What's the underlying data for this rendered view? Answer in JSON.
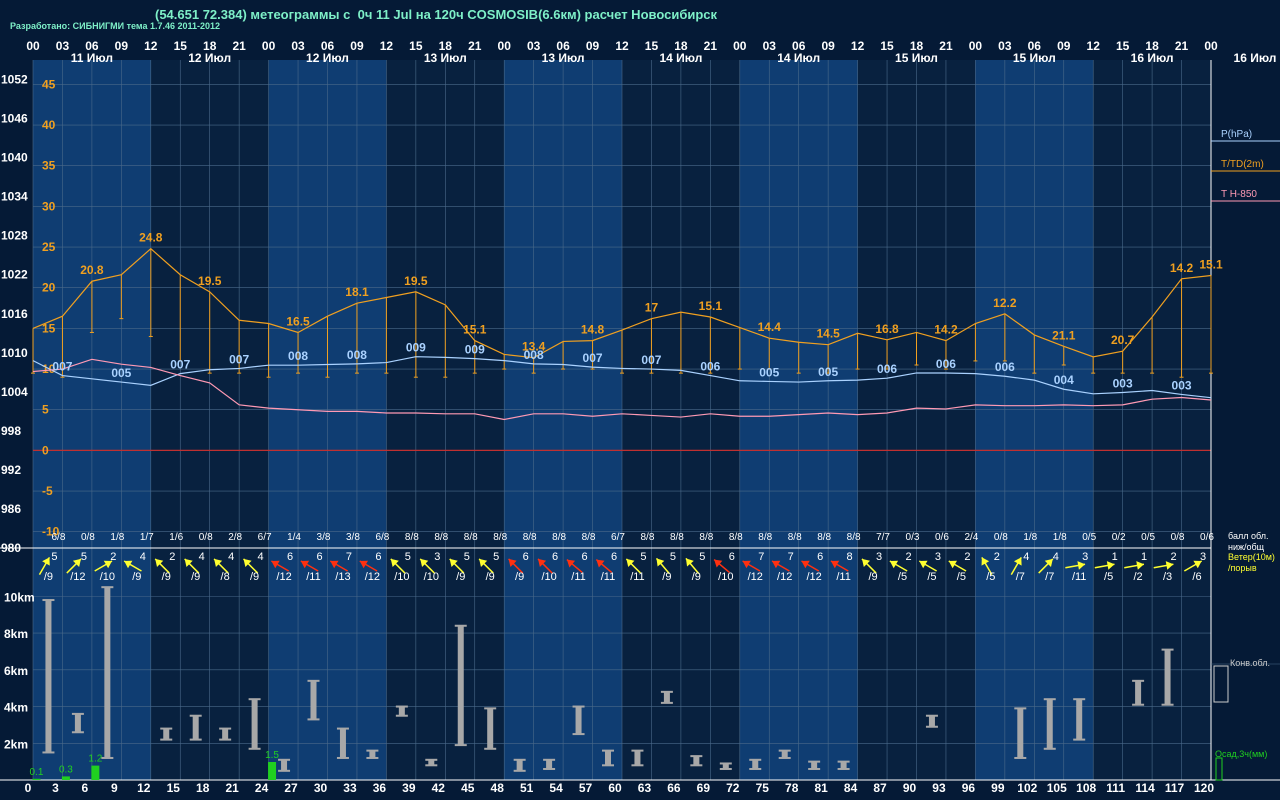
{
  "header": {
    "title": "(54.651 72.384) метеограммы с  0ч 11 Jul на 120ч COSMOSIB(6.6км) расчет Новосибирск",
    "credit": "Разработано: СИБНИГМИ тема 1.7.46 2011-2012"
  },
  "colors": {
    "background": "#051a36",
    "day_band": "#0f3d72",
    "night_band": "#08213f",
    "grid": "#4a6a8a",
    "temperature": "#f0a020",
    "pressure": "#aad2ff",
    "t850": "#ff9ab4",
    "zero_line": "#c03030",
    "wind_light": "#ffff30",
    "wind_strong": "#ff3010",
    "cloud_bar": "#a8a8a8",
    "precip": "#20d020",
    "axis_text": "#ffffff"
  },
  "legend": {
    "pressure": "P(hPa)",
    "temperature": "T/TD(2m)",
    "t850": "T H-850",
    "cloud_cover_line1": "балл обл.",
    "cloud_cover_line2": "ниж/общ",
    "wind_line1": "Ветер(10м)",
    "wind_line2": "/порыв",
    "convective": "Конв.обл.",
    "precip": "Осад,3ч(мм)"
  },
  "chart_data": [
    {
      "type": "line",
      "title": "T/TD(2m), P(hPa), T H-850",
      "hour_labels": [
        "00",
        "03",
        "06",
        "09",
        "12",
        "15",
        "18",
        "21",
        "00",
        "03",
        "06",
        "09",
        "12",
        "15",
        "18",
        "21",
        "00",
        "03",
        "06",
        "09",
        "12",
        "15",
        "18",
        "21",
        "00",
        "03",
        "06",
        "09",
        "12",
        "15",
        "18",
        "21",
        "00",
        "03",
        "06",
        "09",
        "12",
        "15",
        "18",
        "21",
        "00"
      ],
      "day_labels": [
        "11 Июл",
        "12 Июл",
        "12 Июл",
        "13 Июл",
        "13 Июл",
        "14 Июл",
        "14 Июл",
        "15 Июл",
        "15 Июл",
        "16 Июл"
      ],
      "right_day_label": "16 Июл",
      "pressure_axis": [
        1052,
        1046,
        1040,
        1034,
        1028,
        1022,
        1016,
        1010,
        1004,
        998,
        992,
        986,
        980
      ],
      "temperature_axis": [
        45,
        40,
        35,
        30,
        25,
        20,
        15,
        10,
        5,
        0,
        -5,
        -10
      ],
      "temperature_range": [
        -12,
        48
      ],
      "pressure_range": [
        980,
        1055
      ],
      "temperature": [
        15,
        16.5,
        20.8,
        21.6,
        24.8,
        21.6,
        19.5,
        16,
        15.6,
        14.5,
        16.5,
        18.1,
        18.8,
        19.5,
        17.9,
        13.5,
        11.8,
        11.4,
        13.4,
        13.5,
        14.8,
        16.2,
        17,
        16.4,
        15.1,
        13.8,
        13.3,
        13.0,
        14.4,
        13.6,
        14.5,
        13.5,
        15.6,
        16.8,
        14.2,
        12.8,
        11.5,
        12.2,
        16.4,
        21.1,
        21.5,
        20.7,
        18.6,
        14.2,
        14.0,
        15.1
      ],
      "temperature_labels": [
        {
          "i": 2,
          "v": "20.8"
        },
        {
          "i": 4,
          "v": "24.8"
        },
        {
          "i": 6,
          "v": "19.5"
        },
        {
          "i": 9,
          "v": "16.5"
        },
        {
          "i": 11,
          "v": "18.1"
        },
        {
          "i": 13,
          "v": "19.5"
        },
        {
          "i": 15,
          "v": "15.1"
        },
        {
          "i": 17,
          "v": "13.4"
        },
        {
          "i": 19,
          "v": "14.8"
        },
        {
          "i": 21,
          "v": "17"
        },
        {
          "i": 23,
          "v": "15.1"
        },
        {
          "i": 25,
          "v": "14.4"
        },
        {
          "i": 27,
          "v": "14.5"
        },
        {
          "i": 29,
          "v": "16.8"
        },
        {
          "i": 31,
          "v": "14.2"
        },
        {
          "i": 33,
          "v": "12.2"
        },
        {
          "i": 35,
          "v": "21.1"
        },
        {
          "i": 37,
          "v": "20.7"
        },
        {
          "i": 39,
          "v": "14.2"
        },
        {
          "i": 40,
          "v": "15.1"
        }
      ],
      "dewpoint": [
        9.5,
        9.0,
        14.5,
        16.2,
        14.0,
        11.0,
        9.5,
        9.5,
        9.0,
        9.5,
        9.0,
        9.5,
        9.5,
        9.0,
        9.0,
        9.5,
        10.0,
        9.5,
        10.0,
        10.0,
        9.5,
        9.5,
        9.5,
        9.5,
        10.0,
        10.0,
        9.5,
        9.5,
        10.0,
        10.0,
        10.5,
        10.0,
        11.0,
        11.0,
        9.5,
        10.5,
        9.5,
        9.5,
        9.5,
        9.0,
        9.5
      ],
      "pressure": [
        1008.8,
        1006.5,
        1006.0,
        1005.5,
        1005.0,
        1006.8,
        1007.4,
        1007.6,
        1008.1,
        1008.1,
        1008.2,
        1008.3,
        1008.5,
        1009.4,
        1009.3,
        1009.1,
        1008.8,
        1008.3,
        1008.2,
        1007.8,
        1007.6,
        1007.5,
        1007.3,
        1006.5,
        1005.7,
        1005.6,
        1005.5,
        1005.7,
        1005.8,
        1006.1,
        1006.9,
        1006.9,
        1006.8,
        1006.4,
        1005.8,
        1004.4,
        1003.7,
        1003.9,
        1004.2,
        1003.6,
        1003.1
      ],
      "pressure_labels": [
        {
          "i": 1,
          "v": "007"
        },
        {
          "i": 3,
          "v": "005"
        },
        {
          "i": 5,
          "v": "007"
        },
        {
          "i": 7,
          "v": "007"
        },
        {
          "i": 9,
          "v": "008"
        },
        {
          "i": 11,
          "v": "008"
        },
        {
          "i": 13,
          "v": "009"
        },
        {
          "i": 15,
          "v": "009"
        },
        {
          "i": 17,
          "v": "008"
        },
        {
          "i": 19,
          "v": "007"
        },
        {
          "i": 21,
          "v": "007"
        },
        {
          "i": 23,
          "v": "006"
        },
        {
          "i": 25,
          "v": "005"
        },
        {
          "i": 27,
          "v": "005"
        },
        {
          "i": 29,
          "v": "006"
        },
        {
          "i": 31,
          "v": "006"
        },
        {
          "i": 33,
          "v": "006"
        },
        {
          "i": 35,
          "v": "004"
        },
        {
          "i": 37,
          "v": "003"
        },
        {
          "i": 39,
          "v": "003"
        }
      ],
      "t850": [
        9.7,
        10.0,
        11.2,
        10.6,
        10.2,
        9.2,
        8.3,
        5.6,
        5.2,
        5.0,
        4.8,
        4.8,
        4.6,
        4.6,
        4.5,
        4.5,
        3.8,
        4.5,
        4.5,
        4.2,
        4.5,
        4.3,
        4.1,
        4.5,
        4.2,
        4.2,
        4.4,
        4.6,
        4.4,
        4.6,
        5.2,
        5.1,
        5.6,
        5.5,
        5.5,
        5.6,
        5.5,
        5.6,
        6.3,
        6.5,
        6.2
      ]
    },
    {
      "type": "table",
      "title": "балл обл. ниж/общ",
      "values": [
        "6/8",
        "0/8",
        "1/8",
        "1/7",
        "1/6",
        "0/8",
        "2/8",
        "6/7",
        "1/4",
        "3/8",
        "3/8",
        "6/8",
        "8/8",
        "8/8",
        "8/8",
        "8/8",
        "8/8",
        "8/8",
        "8/8",
        "6/7",
        "8/8",
        "8/8",
        "8/8",
        "8/8",
        "8/8",
        "8/8",
        "8/8",
        "8/8",
        "7/7",
        "0/3",
        "0/6",
        "2/4",
        "0/8",
        "1/8",
        "1/8",
        "0/5",
        "0/2",
        "0/5",
        "0/8",
        "0/6"
      ]
    },
    {
      "type": "table",
      "title": "Ветер(10м) /порыв",
      "speed": [
        5,
        5,
        2,
        4,
        2,
        4,
        4,
        4,
        6,
        6,
        7,
        6,
        5,
        3,
        5,
        5,
        6,
        6,
        6,
        6,
        5,
        5,
        5,
        6,
        7,
        7,
        6,
        8,
        3,
        2,
        3,
        2,
        2,
        4,
        4,
        3,
        1,
        1,
        2,
        3
      ],
      "gust": [
        "/9",
        "/12",
        "/10",
        "/9",
        "/9",
        "/9",
        "/8",
        "/9",
        "/12",
        "/11",
        "/13",
        "/12",
        "/10",
        "/10",
        "/9",
        "/9",
        "/9",
        "/10",
        "/11",
        "/11",
        "/11",
        "/9",
        "/9",
        "/10",
        "/12",
        "/12",
        "/12",
        "/11",
        "/9",
        "/5",
        "/5",
        "/5",
        "/5",
        "/7",
        "/7",
        "/11",
        "/5",
        "/2",
        "/3",
        "/6"
      ],
      "direction_deg": [
        30,
        45,
        60,
        300,
        315,
        315,
        315,
        315,
        300,
        300,
        300,
        300,
        315,
        315,
        315,
        315,
        315,
        315,
        310,
        310,
        315,
        320,
        320,
        310,
        300,
        300,
        300,
        300,
        315,
        300,
        300,
        300,
        330,
        30,
        45,
        80,
        80,
        80,
        80,
        60
      ]
    },
    {
      "type": "bar",
      "title": "Конв.обл.",
      "y_axis_labels": [
        "10km",
        "8km",
        "6km",
        "4km",
        "2km"
      ],
      "x_labels": [
        "3",
        "6",
        "9",
        "12",
        "15",
        "18",
        "21",
        "24",
        "27",
        "30",
        "33",
        "36",
        "39",
        "42",
        "45",
        "48",
        "51",
        "54",
        "57",
        "60",
        "63",
        "66",
        "69",
        "72",
        "75",
        "78",
        "81",
        "84",
        "87",
        "90",
        "93",
        "96",
        "99",
        "102",
        "105",
        "108",
        "111",
        "114",
        "117",
        "120"
      ],
      "cloud_base_km": [
        1.5,
        2.6,
        1.2,
        null,
        2.2,
        2.2,
        2.2,
        1.7,
        0.5,
        3.3,
        1.2,
        1.2,
        3.5,
        0.8,
        1.9,
        1.7,
        0.5,
        0.6,
        2.5,
        0.8,
        0.8,
        4.2,
        0.8,
        0.6,
        0.6,
        1.2,
        0.6,
        0.6,
        null,
        null,
        2.9,
        null,
        null,
        1.2,
        1.7,
        2.2,
        null,
        4.1,
        4.1,
        null
      ],
      "cloud_top_km": [
        9.8,
        3.6,
        10.5,
        null,
        2.8,
        3.5,
        2.8,
        4.4,
        1.1,
        5.4,
        2.8,
        1.6,
        4.0,
        1.1,
        8.4,
        3.9,
        1.1,
        1.1,
        4.0,
        1.6,
        1.6,
        4.8,
        1.3,
        0.9,
        1.1,
        1.6,
        1.0,
        1.0,
        null,
        null,
        3.5,
        null,
        null,
        3.9,
        4.4,
        4.4,
        null,
        5.4,
        7.1,
        null
      ],
      "precip_mm": [
        0.1,
        0.3,
        1.2,
        0,
        0,
        0,
        0,
        0,
        1.5,
        0,
        0,
        0,
        0,
        0,
        0,
        0,
        0,
        0,
        0,
        0,
        0,
        0,
        0,
        0,
        0,
        0,
        0,
        0,
        0,
        0,
        0,
        0,
        0,
        0,
        0,
        0,
        0,
        0,
        0,
        0
      ],
      "precip_labels": [
        {
          "i": 0,
          "v": "0.1"
        },
        {
          "i": 1,
          "v": "0.3"
        },
        {
          "i": 2,
          "v": "1.2"
        },
        {
          "i": 8,
          "v": "1.5"
        }
      ],
      "ylim": [
        0,
        11
      ]
    }
  ]
}
